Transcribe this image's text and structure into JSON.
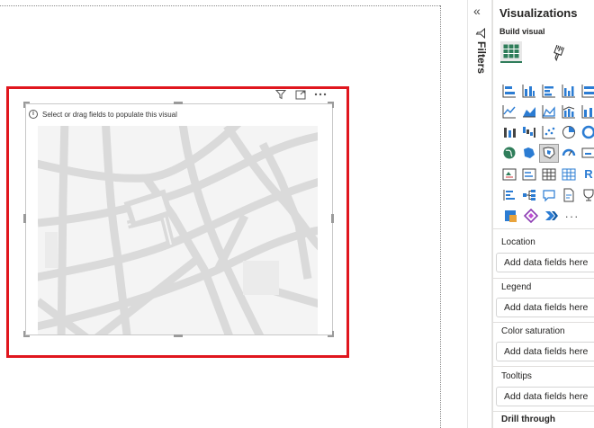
{
  "visual": {
    "hint": "Select or drag fields to populate this visual",
    "header_icons": [
      "filter-icon",
      "focus-mode-icon",
      "more-options-icon"
    ]
  },
  "filters": {
    "label": "Filters",
    "collapse_glyph": "«"
  },
  "pane": {
    "title": "Visualizations",
    "build_label": "Build visual",
    "more_glyph": "···",
    "wells": [
      {
        "label": "Location",
        "placeholder": "Add data fields here"
      },
      {
        "label": "Legend",
        "placeholder": "Add data fields here"
      },
      {
        "label": "Color saturation",
        "placeholder": "Add data fields here"
      },
      {
        "label": "Tooltips",
        "placeholder": "Add data fields here"
      }
    ],
    "drill_through": "Drill through",
    "r_visual_label": "R"
  },
  "colors": {
    "highlight": "#e0161e",
    "accent": "#2f7d5a",
    "icon_blue": "#2b7cd3"
  }
}
